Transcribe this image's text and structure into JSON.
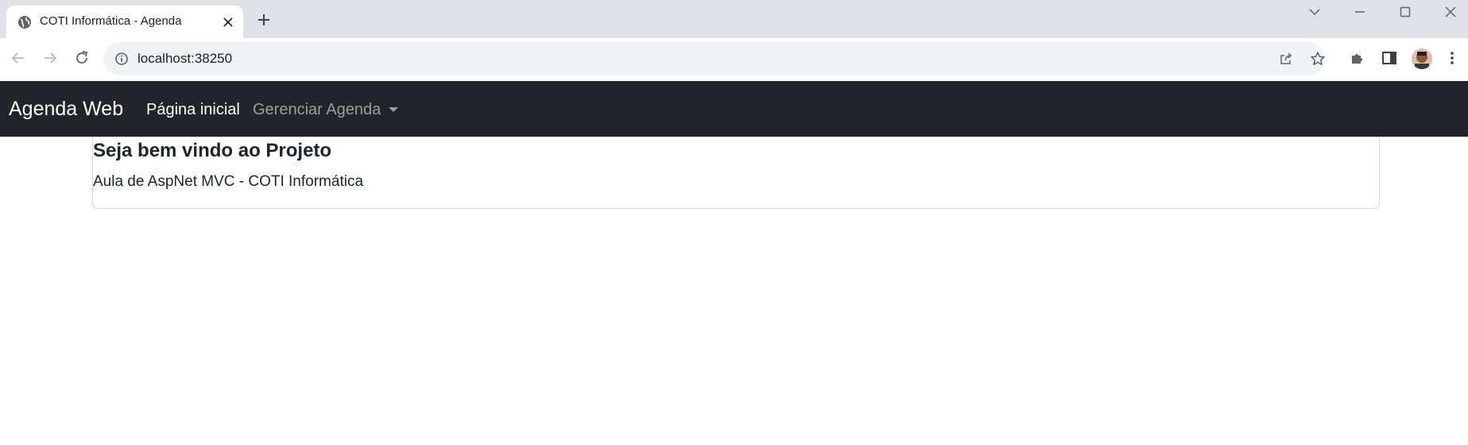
{
  "browser": {
    "tab": {
      "title": "COTI Informática - Agenda"
    },
    "address_bar": {
      "url": "localhost:38250"
    }
  },
  "navbar": {
    "brand": "Agenda Web",
    "items": [
      {
        "label": "Página inicial"
      },
      {
        "label": "Gerenciar Agenda"
      }
    ]
  },
  "main": {
    "title": "Seja bem vindo ao Projeto",
    "subtitle": "Aula de AspNet MVC - COTI Informática"
  }
}
